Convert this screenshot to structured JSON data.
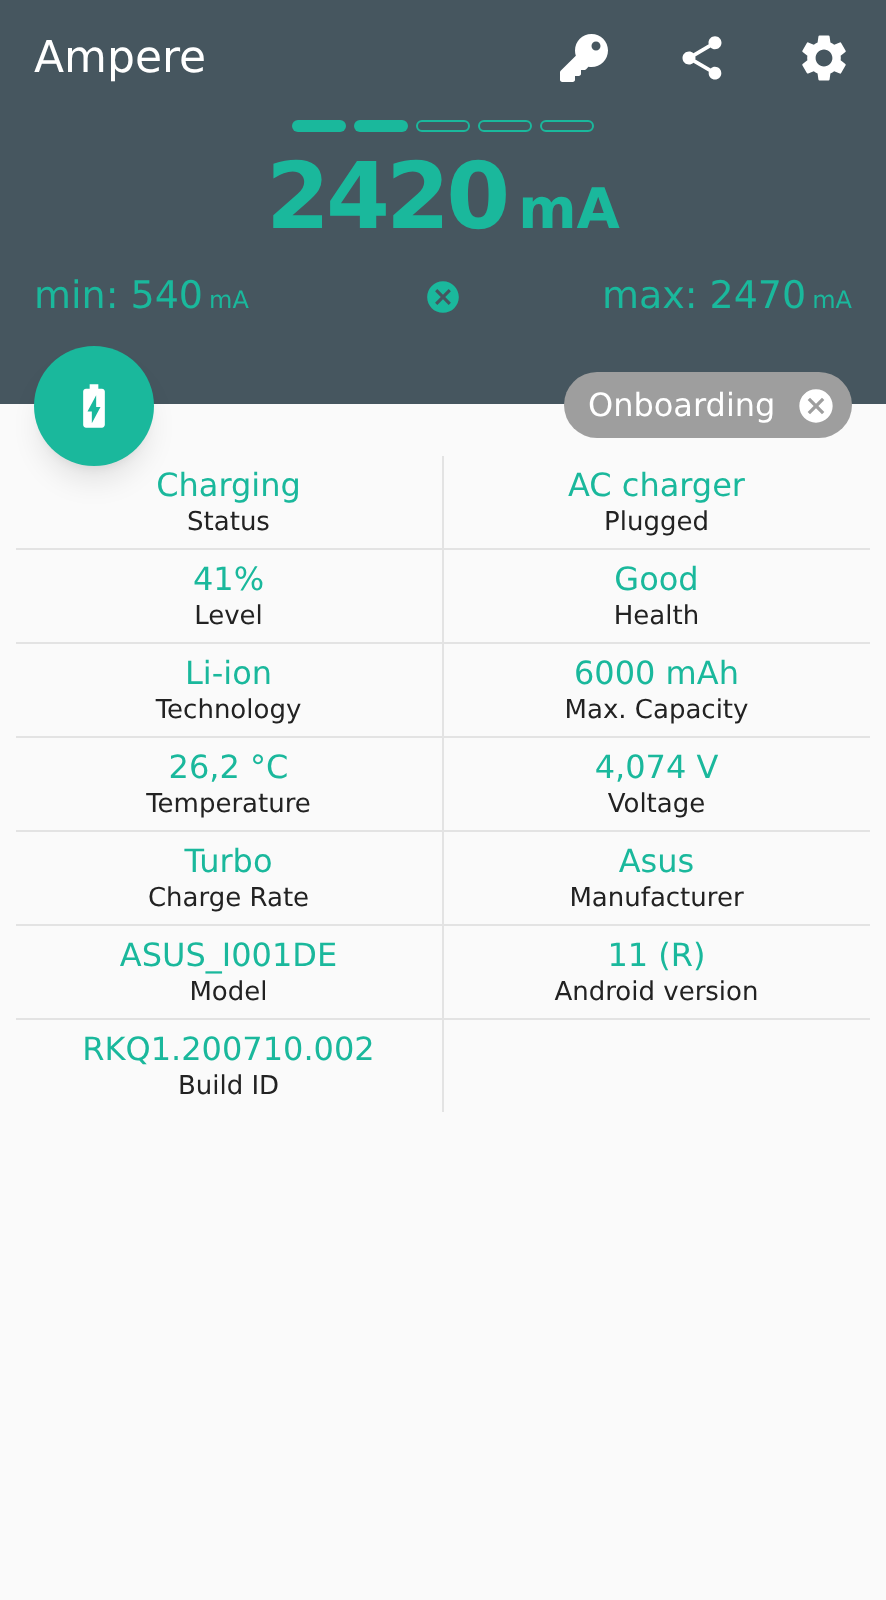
{
  "app_bar": {
    "title": "Ampere"
  },
  "meter": {
    "segments": [
      {
        "filled": true
      },
      {
        "filled": true
      },
      {
        "filled": false
      },
      {
        "filled": false
      },
      {
        "filled": false
      }
    ],
    "current": "2420",
    "current_unit": "mA",
    "min_label": "min:",
    "min_value": "540",
    "min_unit": "mA",
    "max_label": "max:",
    "max_value": "2470",
    "max_unit": "mA"
  },
  "onboarding_chip": {
    "label": "Onboarding"
  },
  "info_cells": [
    {
      "value": "Charging",
      "label": "Status"
    },
    {
      "value": "AC charger",
      "label": "Plugged"
    },
    {
      "value": "41%",
      "label": "Level"
    },
    {
      "value": "Good",
      "label": "Health"
    },
    {
      "value": "Li-ion",
      "label": "Technology"
    },
    {
      "value": "6000 mAh",
      "label": "Max. Capacity"
    },
    {
      "value": "26,2 °C",
      "label": "Temperature"
    },
    {
      "value": "4,074 V",
      "label": "Voltage"
    },
    {
      "value": "Turbo",
      "label": "Charge Rate"
    },
    {
      "value": "Asus",
      "label": "Manufacturer"
    },
    {
      "value": "ASUS_I001DE",
      "label": "Model"
    },
    {
      "value": "11 (R)",
      "label": "Android version"
    },
    {
      "value": "RKQ1.200710.002",
      "label": "Build ID"
    }
  ]
}
